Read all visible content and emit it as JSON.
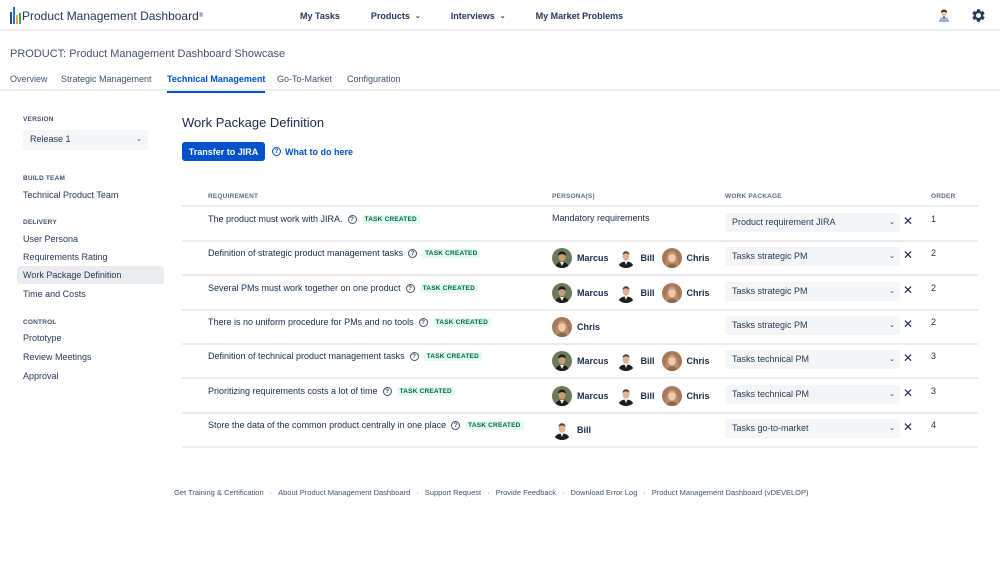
{
  "app": {
    "logo_text": "Product Management Dashboard",
    "logo_reg": "®"
  },
  "topnav": {
    "items": [
      {
        "label": "My Tasks",
        "has_dropdown": false
      },
      {
        "label": "Products",
        "has_dropdown": true
      },
      {
        "label": "Interviews",
        "has_dropdown": true
      },
      {
        "label": "My Market Problems",
        "has_dropdown": false
      }
    ],
    "icons": [
      "user-avatar-icon",
      "gear-icon"
    ]
  },
  "header": {
    "product_title": "PRODUCT: Product Management Dashboard Showcase",
    "tabs": [
      {
        "label": "Overview",
        "active": false
      },
      {
        "label": "Strategic Management",
        "active": false
      },
      {
        "label": "Technical Management",
        "active": true
      },
      {
        "label": "Go-To-Market",
        "active": false
      },
      {
        "label": "Configuration",
        "active": false
      }
    ]
  },
  "sidebar": {
    "version_label": "VERSION",
    "version_value": "Release 1",
    "build_team_label": "BUILD TEAM",
    "build_team_value": "Technical Product Team",
    "delivery_label": "DELIVERY",
    "delivery_items": [
      {
        "label": "User Persona",
        "active": false
      },
      {
        "label": "Requirements Rating",
        "active": false
      },
      {
        "label": "Work Package Definition",
        "active": true
      },
      {
        "label": "Time and Costs",
        "active": false
      }
    ],
    "control_label": "CONTROL",
    "control_items": [
      {
        "label": "Prototype"
      },
      {
        "label": "Review Meetings"
      },
      {
        "label": "Approval"
      }
    ]
  },
  "main": {
    "heading": "Work Package Definition",
    "transfer_button": "Transfer to JIRA",
    "help_link": "What to do here",
    "help_icon": "?",
    "table": {
      "headers": {
        "requirement": "REQUIREMENT",
        "personas": "PERSONA(S)",
        "work_package": "WORK PACKAGE",
        "order": "ORDER"
      },
      "rows": [
        {
          "requirement": "The product must work with JIRA.",
          "status": "TASK CREATED",
          "personas_text": "Mandatory requirements",
          "personas": [],
          "work_package": "Product requirement JIRA",
          "order": "1"
        },
        {
          "requirement": "Definition of strategic product management tasks",
          "status": "TASK CREATED",
          "personas_text": "",
          "personas": [
            "Marcus",
            "Bill",
            "Chris"
          ],
          "work_package": "Tasks strategic PM",
          "order": "2"
        },
        {
          "requirement": "Several PMs must work together on one product",
          "status": "TASK CREATED",
          "personas_text": "",
          "personas": [
            "Marcus",
            "Bill",
            "Chris"
          ],
          "work_package": "Tasks strategic PM",
          "order": "2"
        },
        {
          "requirement": "There is no uniform procedure for PMs and no tools",
          "status": "TASK CREATED",
          "personas_text": "",
          "personas": [
            "Chris"
          ],
          "work_package": "Tasks strategic PM",
          "order": "2"
        },
        {
          "requirement": "Definition of technical product management tasks",
          "status": "TASK CREATED",
          "personas_text": "",
          "personas": [
            "Marcus",
            "Bill",
            "Chris"
          ],
          "work_package": "Tasks technical PM",
          "order": "3"
        },
        {
          "requirement": "Prioritizing requirements costs a lot of time",
          "status": "TASK CREATED",
          "personas_text": "",
          "personas": [
            "Marcus",
            "Bill",
            "Chris"
          ],
          "work_package": "Tasks technical PM",
          "order": "3"
        },
        {
          "requirement": "Store the data of the common product centrally in one place",
          "status": "TASK CREATED",
          "personas_text": "",
          "personas": [
            "Bill"
          ],
          "work_package": "Tasks go-to-market",
          "order": "4"
        }
      ],
      "remove_glyph": "✕",
      "chevron_glyph": "⌄"
    }
  },
  "footer": {
    "links": [
      "Get Training & Certification",
      "About Product Management Dashboard",
      "Support Request",
      "Provide Feedback",
      "Download Error Log",
      "Product Management Dashboard (vDEVELOP)"
    ],
    "separator": "·"
  },
  "colors": {
    "primary": "#0052cc",
    "text_dark": "#172b4d",
    "text_muted": "#42526e",
    "badge_bg": "#e3fcef",
    "badge_text": "#006644",
    "select_bg": "#f4f5f7",
    "divider": "#ebecf0"
  }
}
